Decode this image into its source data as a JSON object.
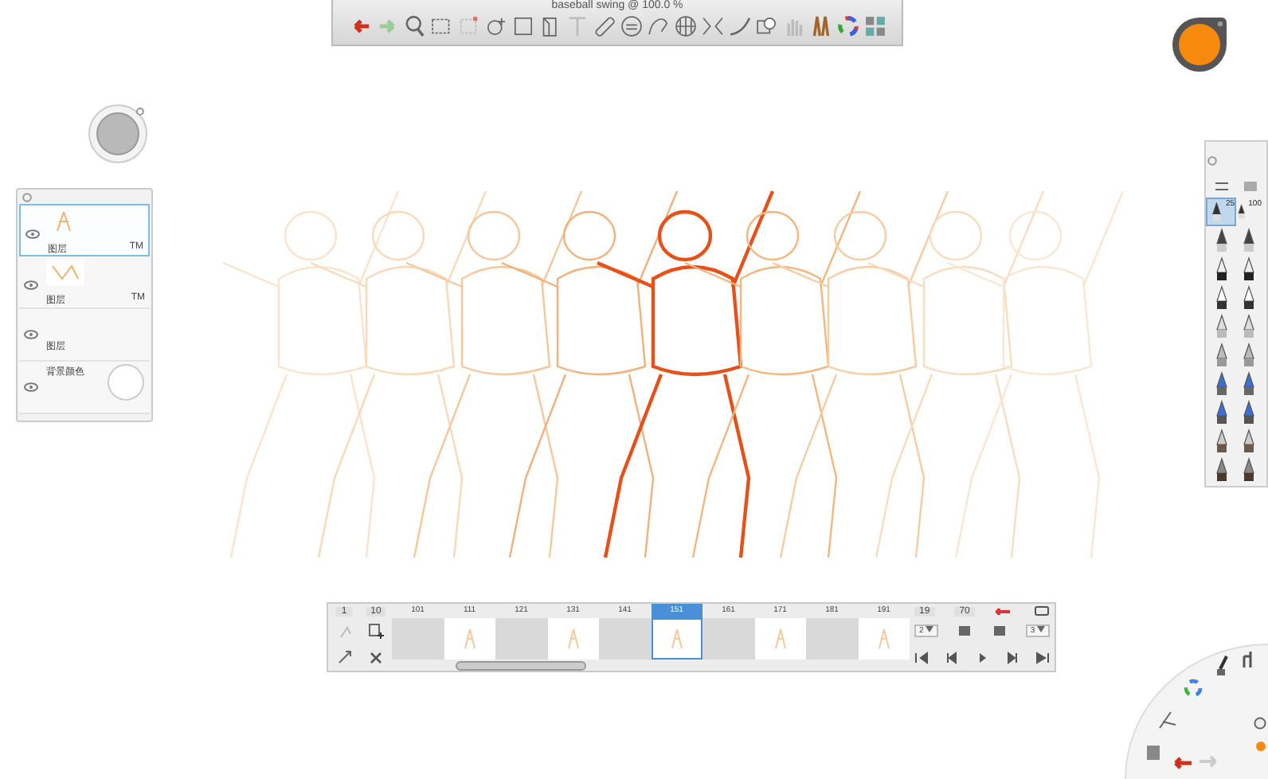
{
  "window": {
    "title": "baseball swing @ 100.0 %"
  },
  "layers": [
    {
      "label": "图层",
      "opacity": "TM",
      "kind": "figure",
      "selected": true
    },
    {
      "label": "图层",
      "opacity": "TM",
      "kind": "group",
      "selected": false
    },
    {
      "label": "图层",
      "kind": "empty",
      "selected": false
    },
    {
      "label": "背景颜色",
      "kind": "background",
      "selected": false
    }
  ],
  "brushes": [
    {
      "size": "25",
      "selected": true
    },
    {
      "size": "100",
      "selected": false
    }
  ],
  "timeline": {
    "start": "1",
    "end": "10",
    "frames": [
      {
        "label": "101",
        "kind": "empty",
        "selected": false
      },
      {
        "label": "111",
        "kind": "drawing",
        "selected": false
      },
      {
        "label": "121",
        "kind": "empty",
        "selected": false
      },
      {
        "label": "131",
        "kind": "drawing",
        "selected": false
      },
      {
        "label": "141",
        "kind": "empty",
        "selected": false
      },
      {
        "label": "151",
        "kind": "drawing",
        "selected": true
      },
      {
        "label": "161",
        "kind": "empty",
        "selected": false
      },
      {
        "label": "171",
        "kind": "drawing",
        "selected": false
      },
      {
        "label": "181",
        "kind": "empty",
        "selected": false
      },
      {
        "label": "191",
        "kind": "drawing",
        "selected": false
      }
    ],
    "current": "19",
    "total": "70",
    "frames_before": "2",
    "frames_after": "3"
  }
}
